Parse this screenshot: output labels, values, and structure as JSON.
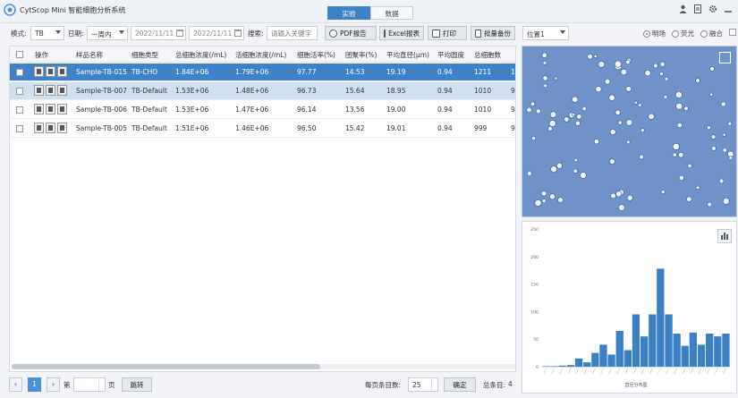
{
  "app": {
    "title": "CytScop Mini 智能细胞分析系统"
  },
  "main_tabs": [
    {
      "label": "实验",
      "active": true
    },
    {
      "label": "数据",
      "active": false
    }
  ],
  "toolbar": {
    "mode_label": "模式:",
    "mode_value": "TB",
    "date_label": "日期:",
    "date_range": "一周内",
    "date_from": "2022/11/11",
    "date_to": "2022/11/11",
    "search_label": "搜索:",
    "search_placeholder": "请输入关键字",
    "pdf_label": "PDF报告",
    "excel_label": "Excel报表",
    "print_label": "打印",
    "batch_backup_label": "批量备份"
  },
  "view": {
    "position_value": "位置1",
    "modes": [
      {
        "label": "明场",
        "selected": true
      },
      {
        "label": "荧光",
        "selected": false
      },
      {
        "label": "融合",
        "selected": false
      }
    ]
  },
  "table": {
    "headers": [
      "操作",
      "样品名称",
      "细胞类型",
      "总细胞浓度(/mL)",
      "活细胞浓度(/mL)",
      "细胞活率(%)",
      "团聚率(%)",
      "平均直径(μm)",
      "平均圆度",
      "总细胞数"
    ],
    "rows": [
      {
        "name": "Sample-TB-015",
        "type": "TB-CHO",
        "total": "1.84E+06",
        "live": "1.79E+06",
        "viability": "97.77",
        "cluster": "14.53",
        "diameter": "19.19",
        "circularity": "0.94",
        "count": "1211",
        "extra": "1"
      },
      {
        "name": "Sample-TB-007",
        "type": "TB-Default",
        "total": "1.53E+06",
        "live": "1.48E+06",
        "viability": "96.73",
        "cluster": "15.64",
        "diameter": "18.95",
        "circularity": "0.94",
        "count": "1010",
        "extra": "9"
      },
      {
        "name": "Sample-TB-006",
        "type": "TB-Default",
        "total": "1.53E+06",
        "live": "1.47E+06",
        "viability": "96.14",
        "cluster": "13.56",
        "diameter": "19.00",
        "circularity": "0.94",
        "count": "1010",
        "extra": "9"
      },
      {
        "name": "Sample-TB-005",
        "type": "TB-Default",
        "total": "1.51E+06",
        "live": "1.46E+06",
        "viability": "96.50",
        "cluster": "15.42",
        "diameter": "19.01",
        "circularity": "0.94",
        "count": "999",
        "extra": "9"
      }
    ]
  },
  "pager": {
    "prev": "‹",
    "page": "1",
    "next": "›",
    "page_prefix": "第",
    "page_suffix": "页",
    "jump_label": "跳转",
    "per_page_label": "每页条目数:",
    "per_page_value": "25",
    "confirm_label": "确定",
    "total_label": "总条目:",
    "total_value": "4"
  },
  "chart_data": {
    "type": "bar",
    "xlabel": "直径分布图",
    "ylabel": "",
    "ylim": [
      0,
      250
    ],
    "yticks": [
      "250",
      "200",
      "150",
      "100",
      "50",
      "0"
    ],
    "values": [
      1,
      1,
      2,
      3,
      15,
      8,
      25,
      40,
      22,
      65,
      30,
      95,
      55,
      95,
      178,
      95,
      60,
      38,
      62,
      40,
      60,
      55,
      60
    ]
  }
}
